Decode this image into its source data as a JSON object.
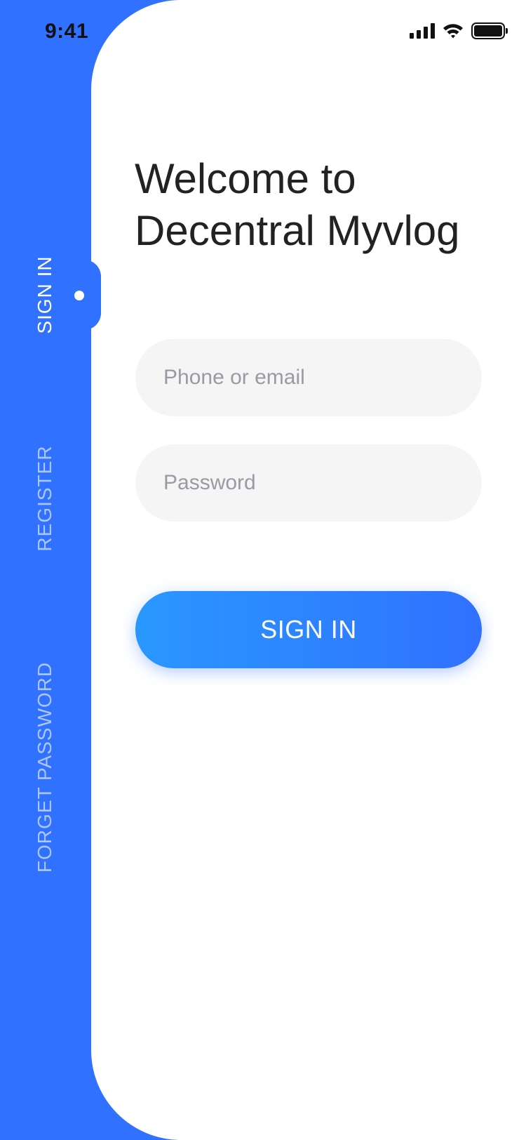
{
  "status_bar": {
    "time": "9:41",
    "icons": [
      "signal-icon",
      "wifi-icon",
      "battery-icon"
    ]
  },
  "side_nav": {
    "items": [
      {
        "label": "SIGN IN",
        "active": true
      },
      {
        "label": "REGISTER",
        "active": false
      },
      {
        "label": "FORGET  PASSWORD",
        "active": false
      }
    ]
  },
  "heading": {
    "line1": "Welcome to",
    "line2": "Decentral Myvlog"
  },
  "form": {
    "identity_placeholder": "Phone or email",
    "password_placeholder": "Password",
    "submit_label": "SIGN IN"
  },
  "colors": {
    "accent": "#3071FF",
    "button_gradient_start": "#2A97FF",
    "button_gradient_end": "#3071FF",
    "field_background": "#F5F5F5",
    "decor_circle": "#DFEAFD"
  }
}
